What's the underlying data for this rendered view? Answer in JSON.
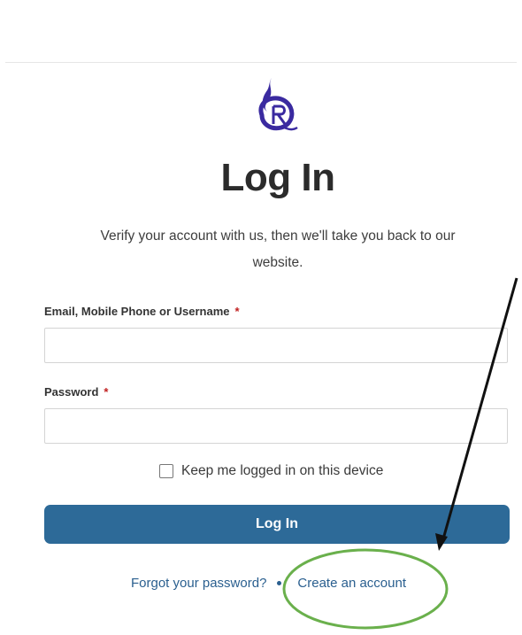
{
  "header": {
    "title": "Log In",
    "subtitle": "Verify your account with us, then we'll take you back to our website."
  },
  "form": {
    "email": {
      "label": "Email, Mobile Phone or Username",
      "required_mark": "*",
      "value": ""
    },
    "password": {
      "label": "Password",
      "required_mark": "*",
      "value": ""
    },
    "keep_logged_in": {
      "label": "Keep me logged in on this device",
      "checked": false
    },
    "submit_label": "Log In"
  },
  "links": {
    "forgot_password": "Forgot your password?",
    "create_account": "Create an account"
  },
  "colors": {
    "primary_button": "#2d6a98",
    "link": "#2a5f8f",
    "logo": "#3a2aa0",
    "required": "#c02020",
    "annotation_circle": "#6ab04c",
    "annotation_arrow": "#111111"
  },
  "icons": {
    "logo": "flame-r-logo",
    "checkbox": "checkbox-unchecked"
  }
}
